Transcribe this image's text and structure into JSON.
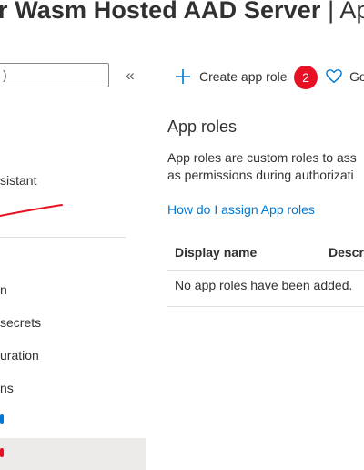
{
  "header": {
    "title_main": "r Wasm Hosted AAD Server",
    "title_sep": " | ",
    "title_section": "App"
  },
  "sidebar": {
    "search_value": ")",
    "collapse_glyph": "«",
    "items": [
      {
        "label": "sistant"
      },
      {
        "label": "n"
      },
      {
        "label": "secrets"
      },
      {
        "label": "uration"
      },
      {
        "label": "ns"
      }
    ]
  },
  "toolbar": {
    "create_label": "Create app role",
    "badge_number": "2",
    "got_label": "Go"
  },
  "main": {
    "heading": "App roles",
    "desc_line1": "App roles are custom roles to ass",
    "desc_line2": "as permissions during authorizati",
    "link": "How do I assign App roles",
    "table": {
      "col_display_name": "Display name",
      "col_description": "Descri",
      "empty_message": "No app roles have been added."
    }
  },
  "colors": {
    "accent": "#0078d4",
    "annotation_red": "#e81123",
    "selected_bg": "#edebe9"
  }
}
